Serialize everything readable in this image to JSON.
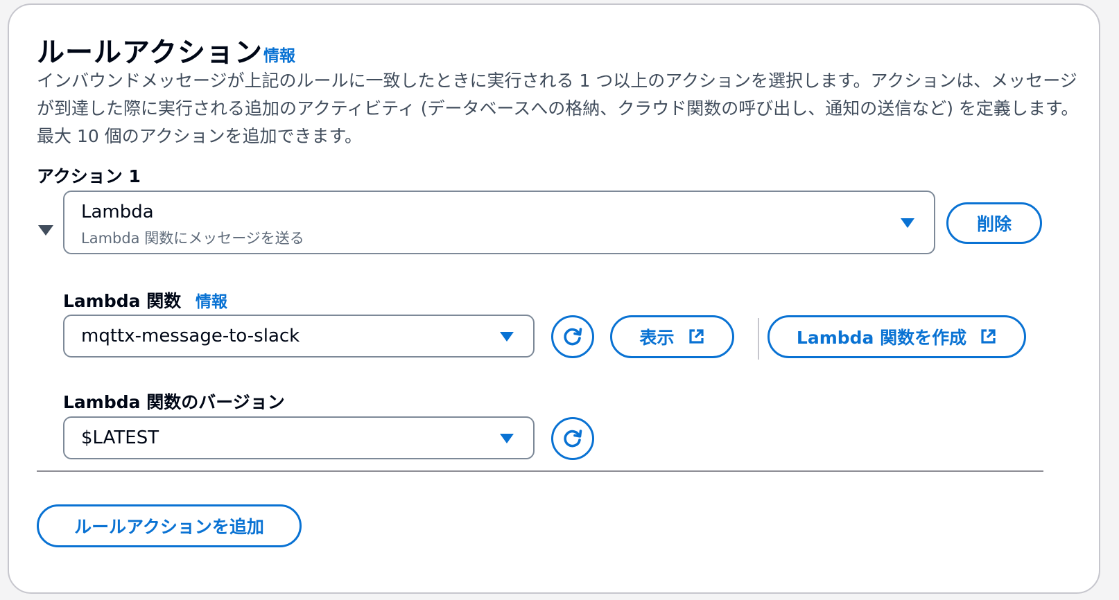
{
  "header": {
    "title": "ルールアクション",
    "info_link": "情報",
    "description": "インバウンドメッセージが上記のルールに一致したときに実行される 1 つ以上のアクションを選択します。アクションは、メッセージが到達した際に実行される追加のアクティビティ (データベースへの格納、クラウド関数の呼び出し、通知の送信など) を定義します。最大 10 個のアクションを追加できます。"
  },
  "action": {
    "heading": "アクション 1",
    "type_select": {
      "value": "Lambda",
      "description": "Lambda 関数にメッセージを送る"
    },
    "remove_label": "削除",
    "function": {
      "label": "Lambda 関数",
      "info_link": "情報",
      "value": "mqttx-message-to-slack",
      "view_label": "表示",
      "create_label": "Lambda 関数を作成"
    },
    "version": {
      "label": "Lambda 関数のバージョン",
      "value": "$LATEST"
    }
  },
  "footer": {
    "add_action_label": "ルールアクションを追加"
  },
  "colors": {
    "accent": "#0972d3",
    "border": "#7d8998",
    "text": "#000716",
    "secondary_text": "#414d5c"
  },
  "icons": [
    "caret-down-icon",
    "dropdown-arrow-icon",
    "refresh-icon",
    "external-link-icon"
  ]
}
